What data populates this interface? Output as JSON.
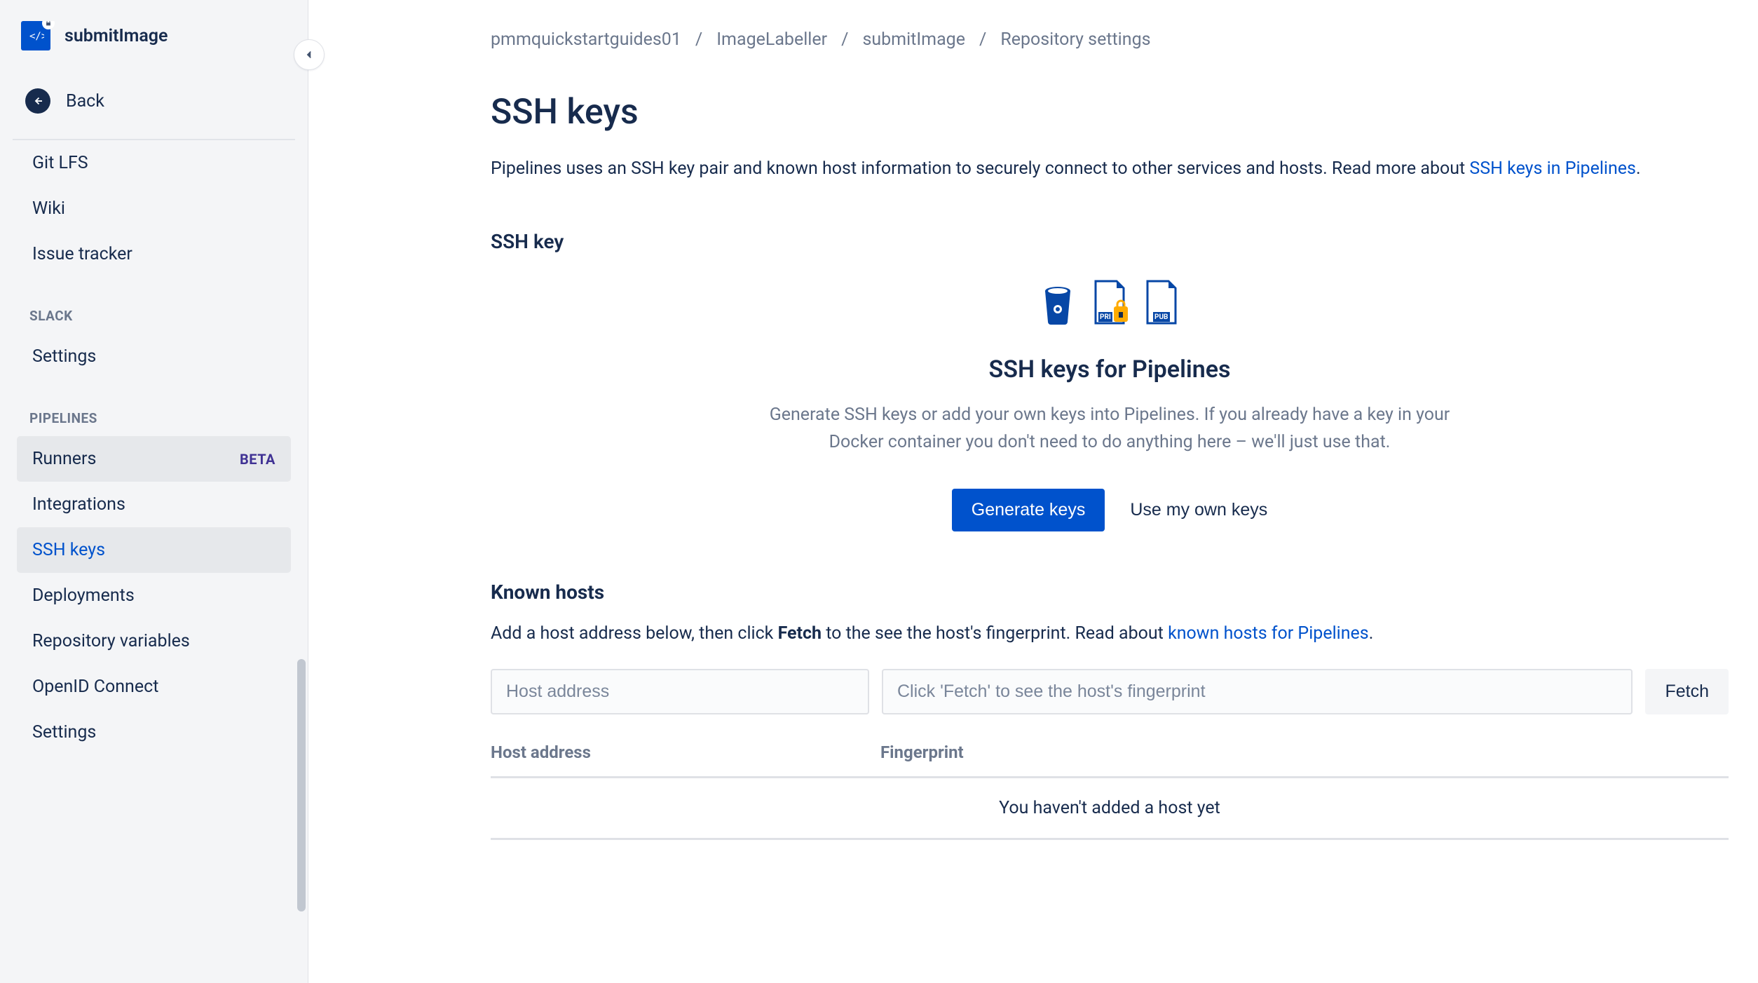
{
  "sidebar": {
    "repo_name": "submitImage",
    "back_label": "Back",
    "items_top": [
      {
        "label": "Git LFS"
      },
      {
        "label": "Wiki"
      },
      {
        "label": "Issue tracker"
      }
    ],
    "slack_header": "SLACK",
    "slack_items": [
      {
        "label": "Settings"
      }
    ],
    "pipelines_header": "PIPELINES",
    "pipelines_items": [
      {
        "label": "Runners",
        "badge": "BETA",
        "highlighted": true
      },
      {
        "label": "Integrations"
      },
      {
        "label": "SSH keys",
        "active": true
      },
      {
        "label": "Deployments"
      },
      {
        "label": "Repository variables"
      },
      {
        "label": "OpenID Connect"
      },
      {
        "label": "Settings"
      }
    ]
  },
  "breadcrumb": [
    "pmmquickstartguides01",
    "ImageLabeller",
    "submitImage",
    "Repository settings"
  ],
  "page_title": "SSH keys",
  "intro_text": "Pipelines uses an SSH key pair and known host information to securely connect to other services and hosts. Read more about ",
  "intro_link": "SSH keys in Pipelines",
  "intro_suffix": ".",
  "ssh_key_header": "SSH key",
  "ssh_panel": {
    "title": "SSH keys for Pipelines",
    "desc": "Generate SSH keys or add your own keys into Pipelines. If you already have a key in your Docker container you don't need to do anything here – we'll just use that.",
    "generate_btn": "Generate keys",
    "own_btn": "Use my own keys"
  },
  "known_hosts": {
    "title": "Known hosts",
    "desc_prefix": "Add a host address below, then click ",
    "desc_bold": "Fetch",
    "desc_mid": " to the see the host's fingerprint. Read about ",
    "desc_link": "known hosts for Pipelines",
    "desc_suffix": ".",
    "host_placeholder": "Host address",
    "fingerprint_placeholder": "Click 'Fetch' to see the host's fingerprint",
    "fetch_btn": "Fetch",
    "th_host": "Host address",
    "th_fingerprint": "Fingerprint",
    "empty": "You haven't added a host yet"
  }
}
